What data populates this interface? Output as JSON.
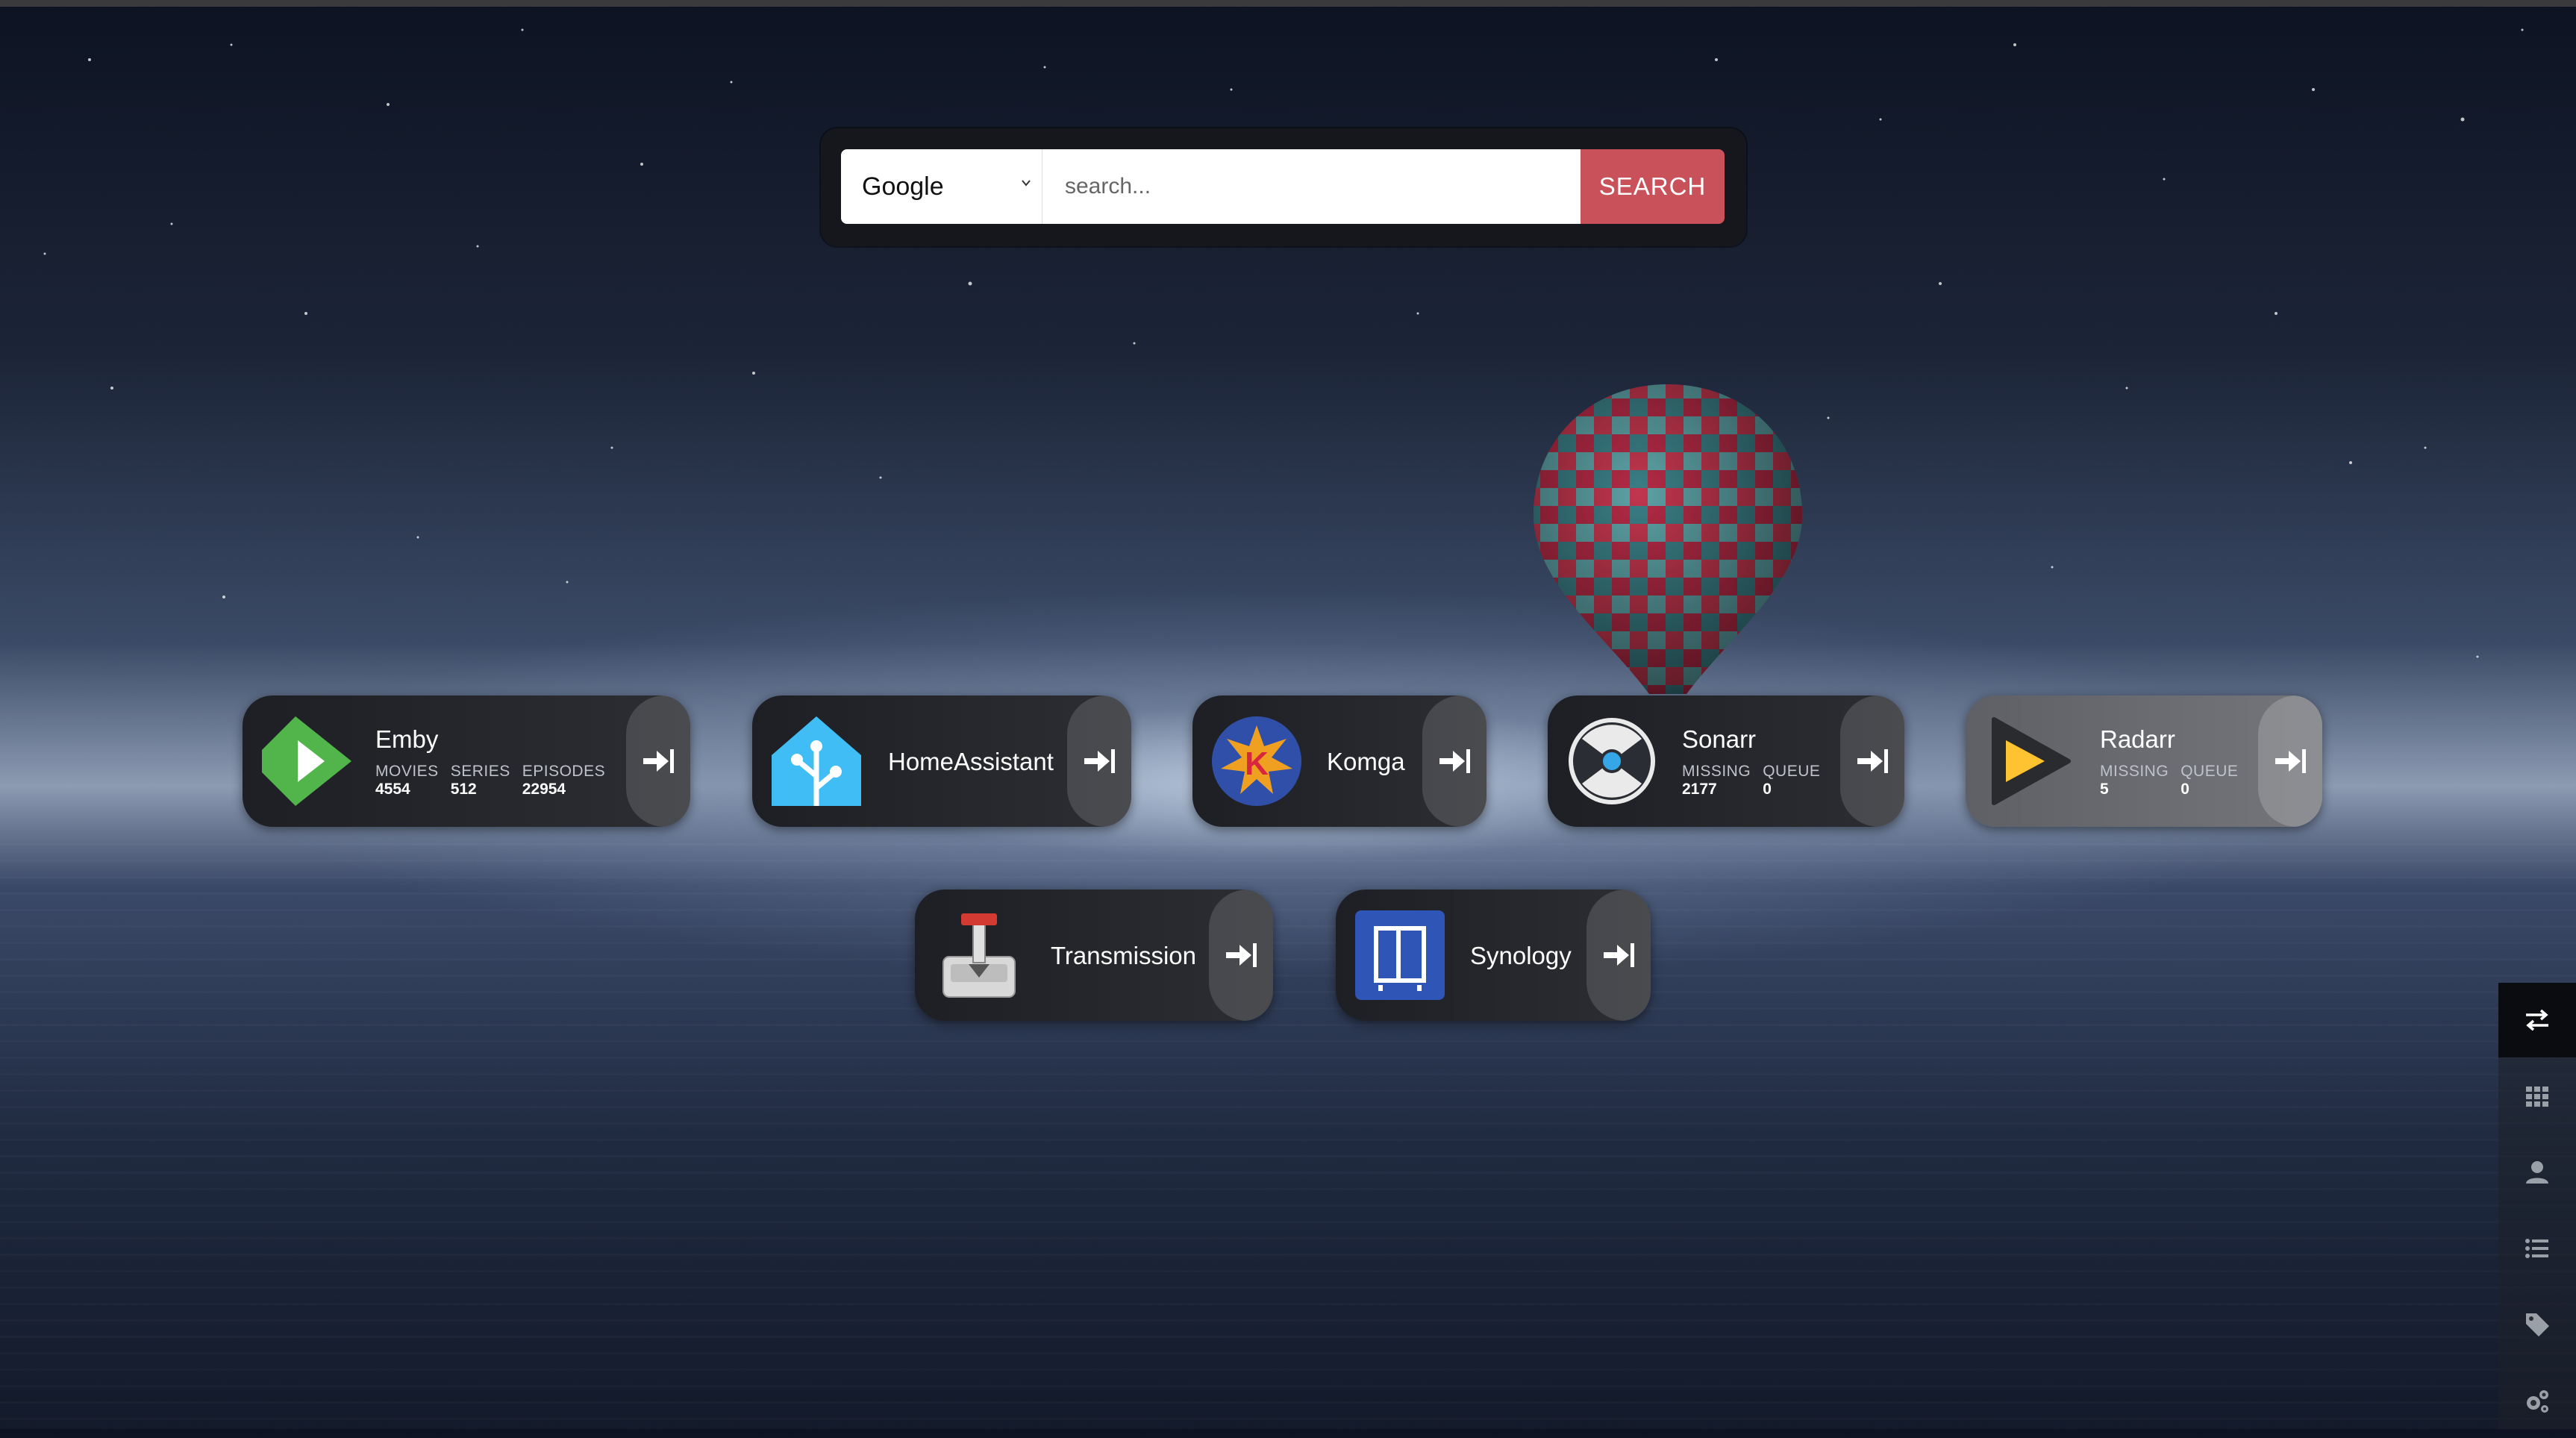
{
  "search": {
    "engine": "Google",
    "placeholder": "search...",
    "button_label": "SEARCH"
  },
  "apps": [
    {
      "name": "Emby",
      "icon": "emby-icon",
      "stats": [
        {
          "label": "MOVIES",
          "value": "4554"
        },
        {
          "label": "SERIES",
          "value": "512"
        },
        {
          "label": "EPISODES",
          "value": "22954"
        }
      ]
    },
    {
      "name": "HomeAssistant",
      "icon": "home-assistant-icon"
    },
    {
      "name": "Komga",
      "icon": "komga-icon"
    },
    {
      "name": "Sonarr",
      "icon": "sonarr-icon",
      "stats": [
        {
          "label": "MISSING",
          "value": "2177"
        },
        {
          "label": "QUEUE",
          "value": "0"
        }
      ]
    },
    {
      "name": "Radarr",
      "icon": "radarr-icon",
      "stats": [
        {
          "label": "MISSING",
          "value": "5"
        },
        {
          "label": "QUEUE",
          "value": "0"
        }
      ]
    },
    {
      "name": "Transmission",
      "icon": "transmission-icon"
    },
    {
      "name": "Synology",
      "icon": "synology-icon"
    }
  ],
  "toolbar": [
    {
      "icon": "swap-arrows-icon",
      "active": true
    },
    {
      "icon": "grid-icon"
    },
    {
      "icon": "user-icon"
    },
    {
      "icon": "list-icon"
    },
    {
      "icon": "tag-icon"
    },
    {
      "icon": "gears-icon"
    }
  ],
  "colors": {
    "search_button": "#c9525a",
    "tile_bg": "#1d1f24",
    "emby": "#52b54b",
    "home_assistant": "#41bdf5",
    "synology": "#2f55b6",
    "radarr": "#ffc230"
  }
}
